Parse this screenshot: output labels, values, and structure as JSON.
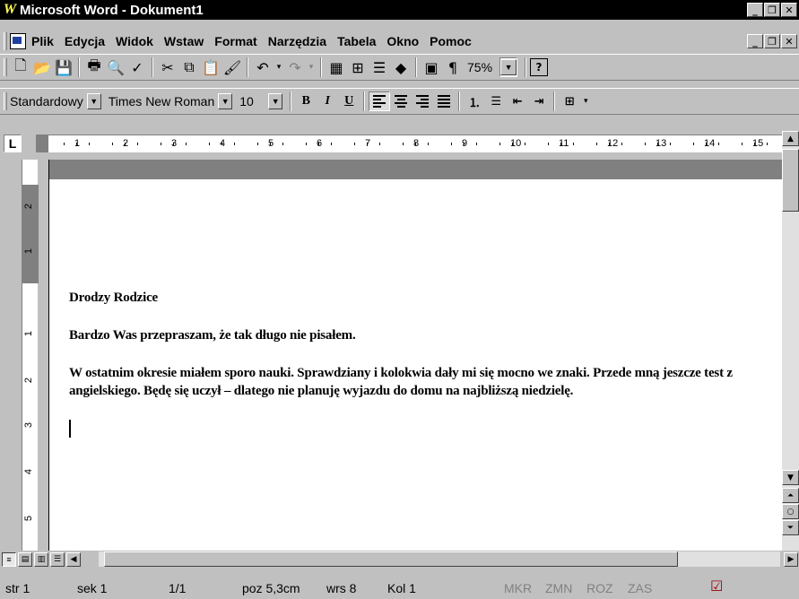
{
  "window": {
    "title": "Microsoft Word - Dokument1",
    "app_logo": "W"
  },
  "menu": {
    "items": [
      {
        "label": "Plik"
      },
      {
        "label": "Edycja"
      },
      {
        "label": "Widok"
      },
      {
        "label": "Wstaw"
      },
      {
        "label": "Format"
      },
      {
        "label": "Narzędzia"
      },
      {
        "label": "Tabela"
      },
      {
        "label": "Okno"
      },
      {
        "label": "Pomoc"
      }
    ]
  },
  "toolbar_standard": {
    "zoom": "75%"
  },
  "toolbar_format": {
    "style": "Standardowy",
    "font": "Times New Roman",
    "size": "10"
  },
  "ruler": {
    "h_numbers": [
      "1",
      "2",
      "3",
      "4",
      "5",
      "6",
      "7",
      "8",
      "9",
      "10",
      "11",
      "12",
      "13",
      "14",
      "15"
    ],
    "v_numbers": [
      "2",
      "1",
      "1",
      "2",
      "3",
      "4",
      "5"
    ]
  },
  "document": {
    "paragraphs": [
      "Drodzy Rodzice",
      "Bardzo Was przepraszam, że tak długo nie pisałem.",
      "W ostatnim okresie miałem sporo nauki. Sprawdziany i kolokwia dały mi się mocno we znaki. Przede mną jeszcze test z angielskiego. Będę się uczył – dlatego nie planuję wyjazdu do domu na najbliższą niedzielę."
    ]
  },
  "status": {
    "page": "str 1",
    "section": "sek 1",
    "pages": "1/1",
    "position": "poz 5,3cm",
    "line": "wrs 8",
    "column": "Kol 1",
    "mkr": "MKR",
    "zmn": "ZMN",
    "roz": "ROZ",
    "zas": "ZAS"
  }
}
